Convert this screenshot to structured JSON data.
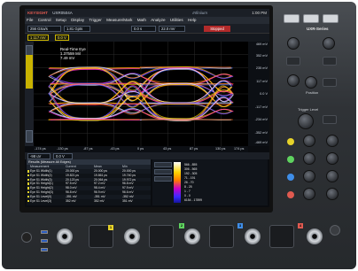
{
  "titlebar": {
    "brand": "KEYSIGHT",
    "model": "UXR0504A",
    "logo": "Infiniium",
    "series": "UXR-Series",
    "right": "1:00 PM"
  },
  "menubar": {
    "items": [
      "File",
      "Control",
      "Setup",
      "Display",
      "Trigger",
      "Measure/Mark",
      "Math",
      "Analyze",
      "Utilities",
      "Help"
    ]
  },
  "toolbar": {
    "timebase": "256 GSa/s",
    "points": "1.81 Gpts",
    "delay": "0.0 s",
    "trigger": "22.0 mV",
    "acq_status": "Stopped"
  },
  "channel_tab": {
    "label": "1",
    "scale": "117 mV",
    "offset": "0.0 V"
  },
  "annotation": {
    "line1": "Real-Time Eye",
    "line2": "1.37559 Mil",
    "line3": "7.49 mV"
  },
  "y_axis": {
    "labels": [
      "469 mV",
      "352 mV",
      "235 mV",
      "117 mV",
      "0.0 V",
      "-117 mV",
      "-234 mV",
      "-352 mV",
      "-469 mV"
    ]
  },
  "x_axis": {
    "labels": [
      "-174 ps",
      "-130 ps",
      "-87 ps",
      "-43 ps",
      "0 ps",
      "43 ps",
      "87 ps",
      "130 ps",
      "174 ps"
    ]
  },
  "meas_header": {
    "field1": "-98 uV",
    "field2": "0.0 V"
  },
  "measurements": {
    "title": "Results (Measure All Edges)",
    "columns": [
      "Measurement",
      "Current",
      "Mean",
      "Min"
    ],
    "rows": [
      [
        "Eye S1 Width(1)",
        "20.000 ps",
        "20.000 ps",
        "20.000 ps"
      ],
      [
        "Eye S1 Width(2)",
        "19.821 ps",
        "19.861 ps",
        "19.740 ps"
      ],
      [
        "Eye S1 Width(3)",
        "20.123 ps",
        "20.064 ps",
        "19.972 ps"
      ],
      [
        "Eye S1 Height(1)",
        "97.5 mV",
        "97.2 mV",
        "96.8 mV"
      ],
      [
        "Eye S1 Height(2)",
        "98.0 mV",
        "98.4 mV",
        "97.9 mV"
      ],
      [
        "Eye S1 Height(3)",
        "96.8 mV",
        "96.9 mV",
        "96.6 mV"
      ],
      [
        "Eye S1 Level(0)",
        "-351 mV",
        "-351 mV",
        "-352 mV"
      ],
      [
        "Eye S1 Level(3)",
        "352 mV",
        "352 mV",
        "351 mV"
      ]
    ]
  },
  "heat_legend": [
    "566 - 855",
    "306 - 565",
    "192 - 305",
    "71 - 191",
    "26 - 70",
    "8 - 25",
    "1 - 7",
    "0 - 0",
    "6154 - 17899"
  ],
  "front_panel": {
    "touch_label": "Touch",
    "trigger_level": "Trigger Level",
    "position_label": "Position",
    "scale_label": "Scale",
    "markers_label": "Markers"
  },
  "channels": [
    {
      "label": "1",
      "color": "#e6d22a"
    },
    {
      "label": "2",
      "color": "#5fd35f"
    },
    {
      "label": "3",
      "color": "#3f8ee8"
    },
    {
      "label": "4",
      "color": "#e05a50"
    }
  ]
}
